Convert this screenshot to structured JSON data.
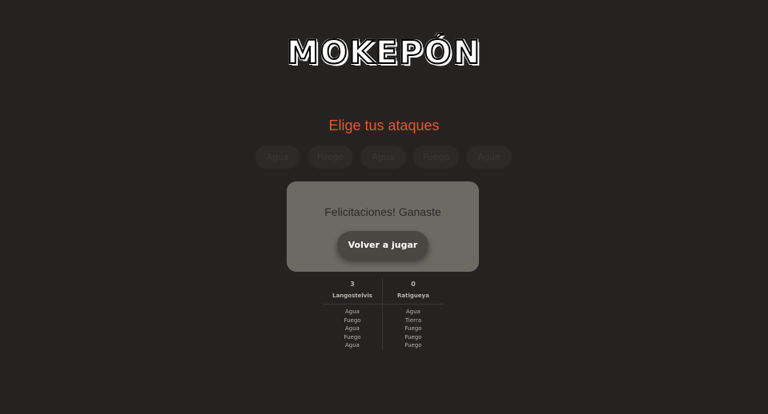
{
  "logo": {
    "title": "MOKEPÓN"
  },
  "attack_section": {
    "heading": "Elige tus ataques",
    "buttons": [
      "Agua",
      "Fuego",
      "Agua",
      "Fuego",
      "Agua"
    ]
  },
  "result": {
    "message": "Felicitaciones! Ganaste",
    "restart_label": "Volver a jugar"
  },
  "scoreboard": {
    "player": {
      "score": "3",
      "name": "Langostelvis",
      "attacks": [
        "Agua",
        "Fuego",
        "Agua",
        "Fuego",
        "Agua"
      ]
    },
    "enemy": {
      "score": "0",
      "name": "Ratigueya",
      "attacks": [
        "Agua",
        "Tierra",
        "Fuego",
        "Fuego",
        "Fuego"
      ]
    }
  },
  "colors": {
    "background": "#252321",
    "accent": "#e8572e",
    "card": "#6d6a64",
    "button": "#4a4743"
  }
}
